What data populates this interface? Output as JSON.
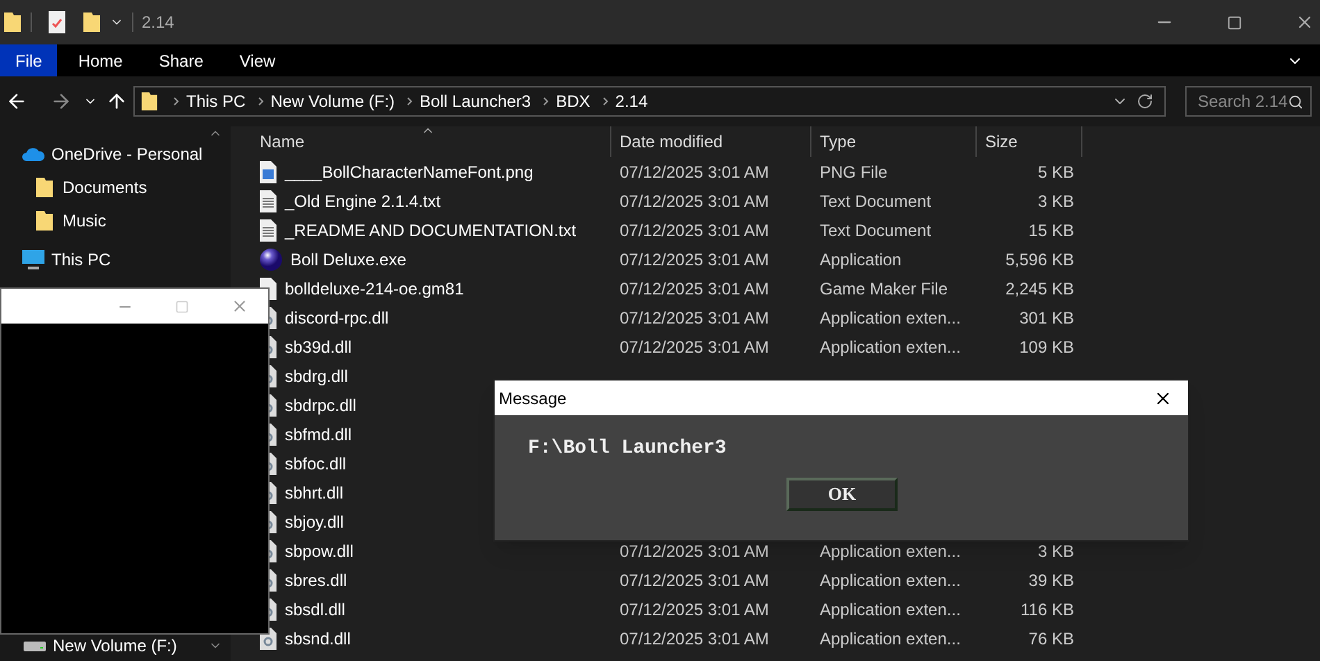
{
  "window": {
    "title": "2.14"
  },
  "ribbon_tabs": [
    {
      "label": "File",
      "selected": true
    },
    {
      "label": "Home",
      "selected": false
    },
    {
      "label": "Share",
      "selected": false
    },
    {
      "label": "View",
      "selected": false
    }
  ],
  "breadcrumb": [
    "This PC",
    "New Volume (F:)",
    "Boll Launcher3",
    "BDX",
    "2.14"
  ],
  "search": {
    "placeholder": "Search 2.14"
  },
  "sidebar": {
    "items": [
      {
        "label": "OneDrive - Personal",
        "kind": "cloud",
        "children": [
          {
            "label": "Documents",
            "kind": "folder"
          },
          {
            "label": "Music",
            "kind": "folder"
          }
        ]
      },
      {
        "label": "This PC",
        "kind": "pc"
      }
    ],
    "bottom_item": {
      "label": "New Volume (F:)",
      "kind": "drive"
    }
  },
  "table": {
    "columns": [
      "Name",
      "Date modified",
      "Type",
      "Size"
    ],
    "rows": [
      {
        "name": "____BollCharacterNameFont.png",
        "kind": "image",
        "date": "07/12/2025 3:01 AM",
        "type": "PNG File",
        "size": "5 KB"
      },
      {
        "name": "_Old Engine 2.1.4.txt",
        "kind": "text",
        "date": "07/12/2025 3:01 AM",
        "type": "Text Document",
        "size": "3 KB"
      },
      {
        "name": "_README AND DOCUMENTATION.txt",
        "kind": "text",
        "date": "07/12/2025 3:01 AM",
        "type": "Text Document",
        "size": "15 KB"
      },
      {
        "name": "Boll Deluxe.exe",
        "kind": "app",
        "date": "07/12/2025 3:01 AM",
        "type": "Application",
        "size": "5,596 KB"
      },
      {
        "name": "bolldeluxe-214-oe.gm81",
        "kind": "blank",
        "date": "07/12/2025 3:01 AM",
        "type": "Game Maker File",
        "size": "2,245 KB"
      },
      {
        "name": "discord-rpc.dll",
        "kind": "dll",
        "date": "07/12/2025 3:01 AM",
        "type": "Application exten...",
        "size": "301 KB"
      },
      {
        "name": "sb39d.dll",
        "kind": "dll",
        "date": "07/12/2025 3:01 AM",
        "type": "Application exten...",
        "size": "109 KB"
      },
      {
        "name": "sbdrg.dll",
        "kind": "dll"
      },
      {
        "name": "sbdrpc.dll",
        "kind": "dll"
      },
      {
        "name": "sbfmd.dll",
        "kind": "dll"
      },
      {
        "name": "sbfoc.dll",
        "kind": "dll"
      },
      {
        "name": "sbhrt.dll",
        "kind": "dll"
      },
      {
        "name": "sbjoy.dll",
        "kind": "dll"
      },
      {
        "name": "sbpow.dll",
        "kind": "dll",
        "date": "07/12/2025 3:01 AM",
        "type": "Application exten...",
        "size": "3 KB"
      },
      {
        "name": "sbres.dll",
        "kind": "dll",
        "date": "07/12/2025 3:01 AM",
        "type": "Application exten...",
        "size": "39 KB"
      },
      {
        "name": "sbsdl.dll",
        "kind": "dll",
        "date": "07/12/2025 3:01 AM",
        "type": "Application exten...",
        "size": "116 KB"
      },
      {
        "name": "sbsnd.dll",
        "kind": "dll",
        "date": "07/12/2025 3:01 AM",
        "type": "Application exten...",
        "size": "76 KB"
      }
    ]
  },
  "message_dialog": {
    "title": "Message",
    "text": "F:\\Boll Launcher3",
    "button": "OK"
  }
}
